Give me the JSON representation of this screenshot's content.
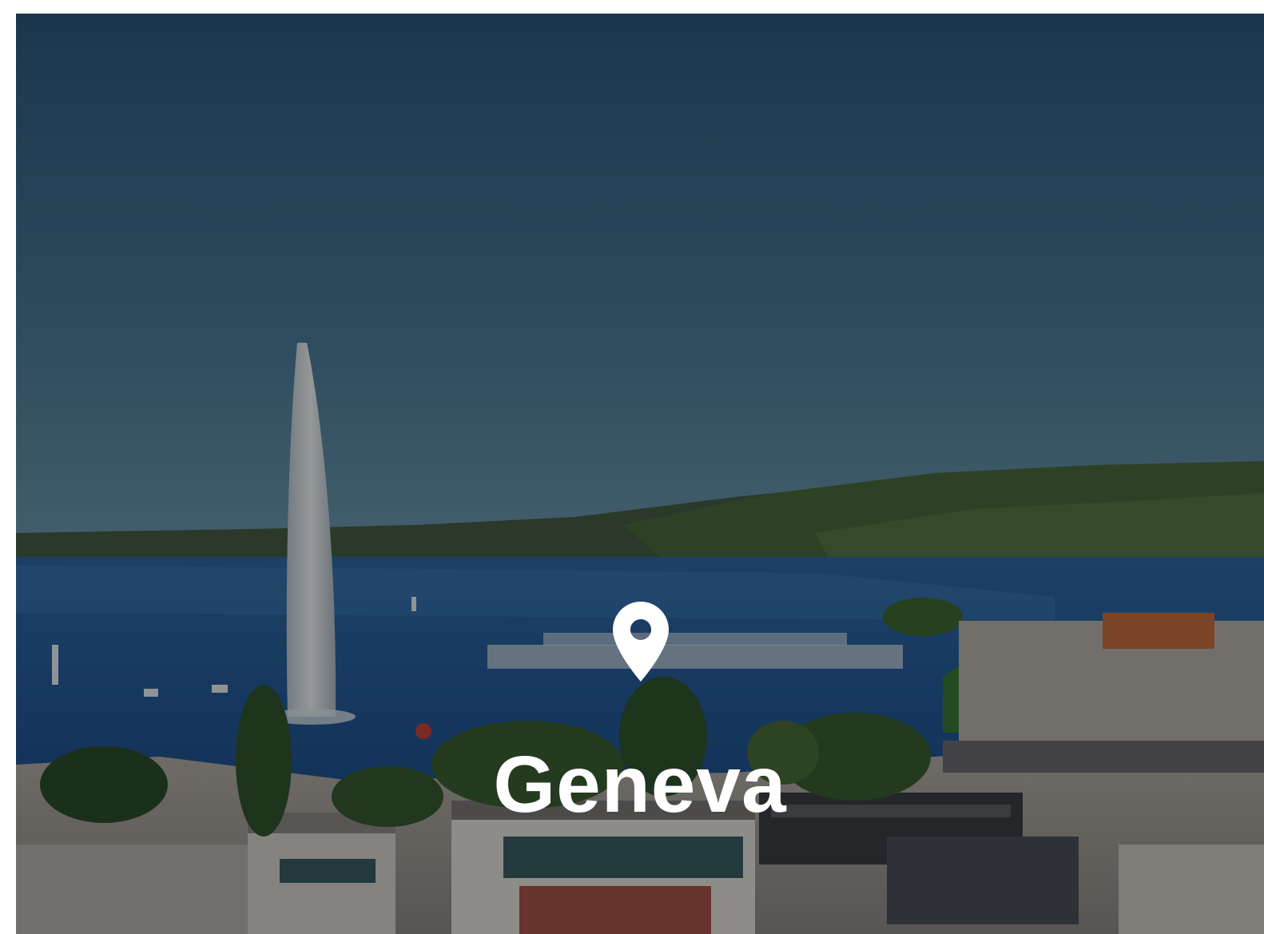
{
  "destination": {
    "city": "Geneva",
    "icon": "map-pin-icon"
  },
  "colors": {
    "sky": "#2f5f7e",
    "lake": "#215c9a",
    "hills": "#3d5a34",
    "text": "#ffffff"
  }
}
